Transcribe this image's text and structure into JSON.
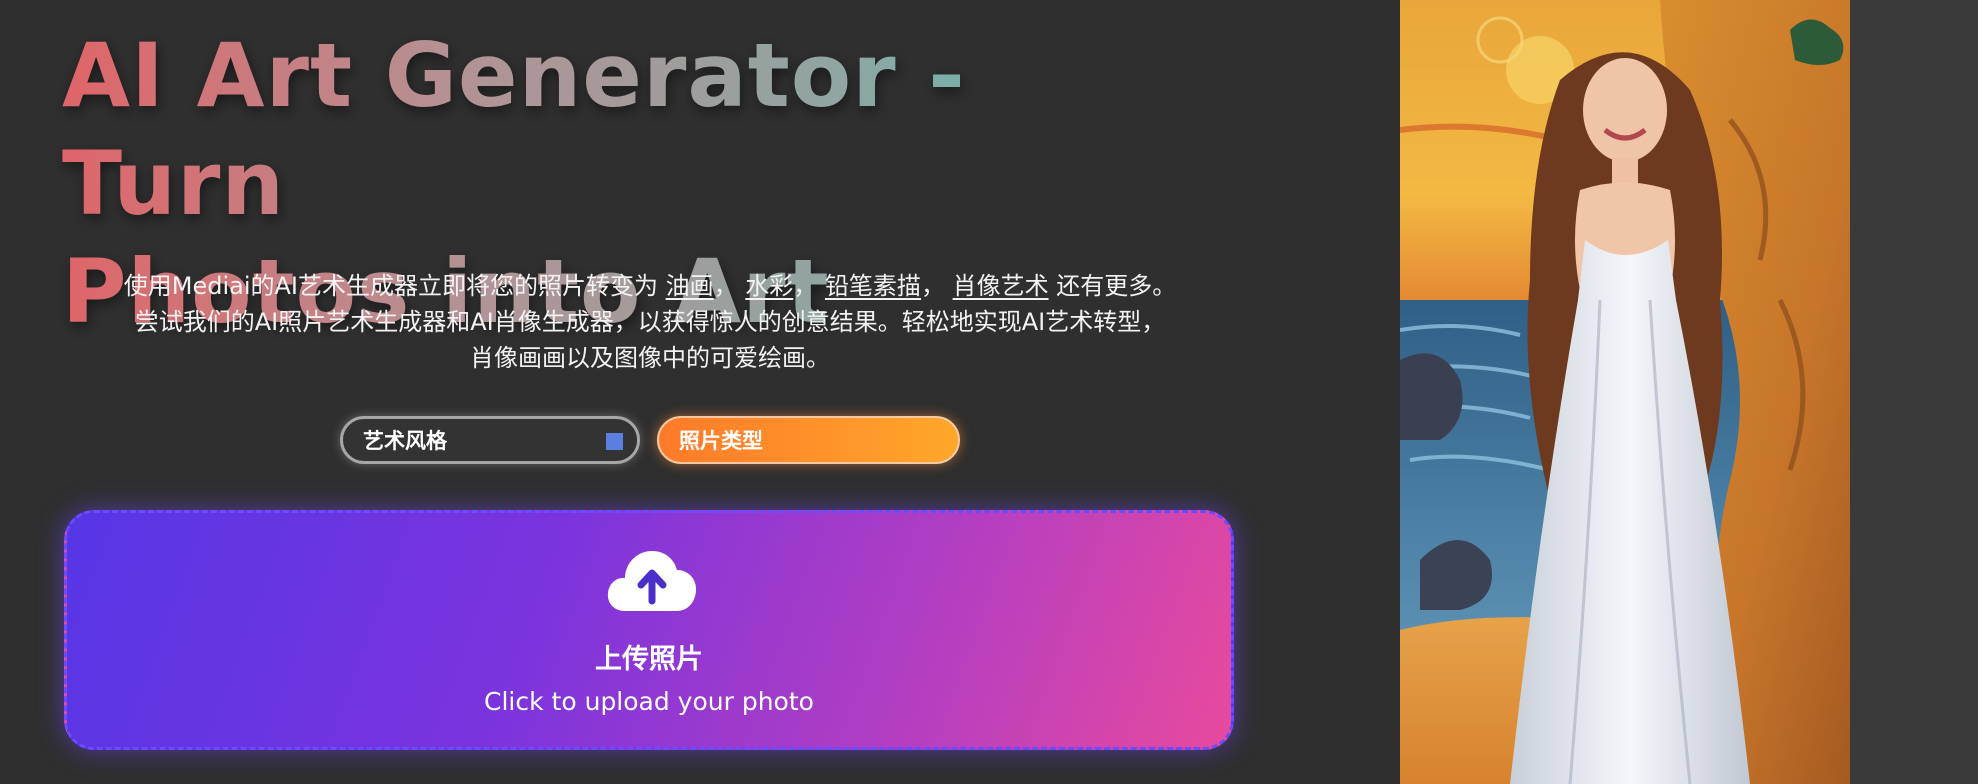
{
  "hero": {
    "title_line1": "AI Art Generator - Turn",
    "title_line2": "Photos into Art"
  },
  "description": {
    "line1_prefix": "使用Mediai的AI艺术生成器立即将您的照片转变为",
    "link_oil": "油画",
    "sep1": "，",
    "link_watercolor": "水彩",
    "sep2": "，",
    "link_pencil": "铅笔素描",
    "sep3": "，",
    "link_portrait": "肖像艺术",
    "line1_suffix": "还有更多。",
    "line2": "尝试我们的AI照片艺术生成器和AI肖像生成器，以获得惊人的创意结果。轻松地实现AI艺术转型，",
    "line3": "肖像画画以及图像中的可爱绘画。"
  },
  "selectors": {
    "art_style": "艺术风格",
    "photo_type": "照片类型"
  },
  "upload": {
    "title": "上传照片",
    "subtitle": "Click to upload your photo",
    "icon": "cloud-upload-icon"
  },
  "colors": {
    "background": "#2f2f2f",
    "title_gradient_start": "#df6569",
    "title_gradient_end": "#52c2b0",
    "photo_type_orange": "#ff8a2a",
    "upload_gradient_start": "#5636e6",
    "upload_gradient_end": "#e84a9d"
  }
}
